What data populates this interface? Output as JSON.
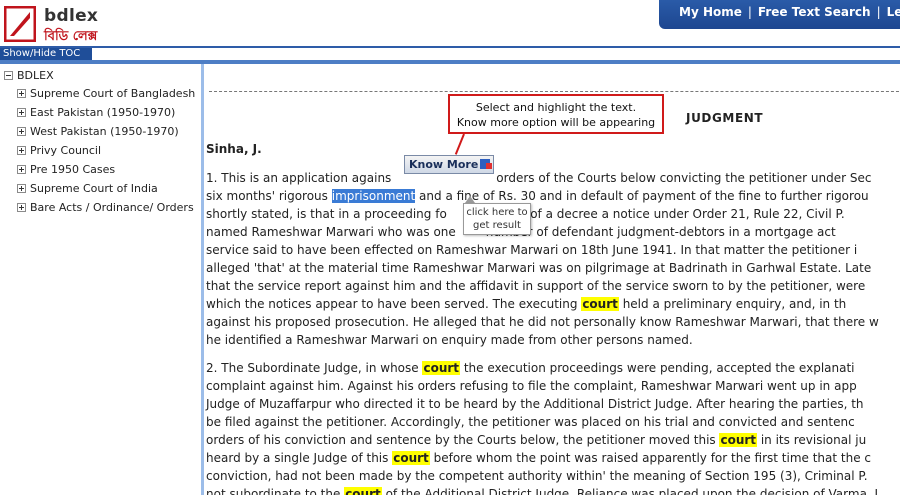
{
  "brand": {
    "name": "bdlex",
    "bangla_name": "বিডি লেক্স",
    "accent_color": "#c0141c",
    "nav_color": "#1f4e99"
  },
  "topnav": {
    "items": [
      "My Home",
      "Free Text Search",
      "Lega"
    ],
    "separator": "|"
  },
  "toc_toggle": "Show/Hide TOC",
  "sidebar": {
    "root": "BDLEX",
    "items": [
      "Supreme Court of Bangladesh",
      "East Pakistan (1950-1970)",
      "West Pakistan (1950-1970)",
      "Privy Council",
      "Pre 1950 Cases",
      "Supreme Court of India",
      "Bare Acts / Ordinance/ Orders"
    ]
  },
  "document": {
    "heading": "JUDGMENT",
    "author": "Sinha, J.",
    "p1": [
      [
        "1. This is an application agains",
        "",
        "",
        "",
        "",
        "orders of the Courts below convicting the petitioner under Sec"
      ],
      [
        "six months' rigorous ",
        "imprisonment",
        " and a fine of Rs. 30 and in default of payment of the fine to further rigorou"
      ],
      [
        "shortly stated, is that in a proceeding fo",
        "",
        "n of a decree a notice under Order 21, Rule 22, Civil P."
      ],
      [
        "named Rameshwar Marwari who was one",
        "",
        "number of defendant judgment-debtors in a mortgage act"
      ],
      [
        "service said to have been effected on Rameshwar Marwari on 18th June 1941. In that matter the petitioner i"
      ],
      [
        "alleged 'that' at the material time Rameshwar Marwari was on pilgrimage at Badrinath in Garhwal Estate. Late"
      ],
      [
        "that the service report against him and the affidavit in support of the service sworn to by the petitioner, were"
      ],
      [
        "which the notices appear to have been served. The executing ",
        "court",
        " held a preliminary enquiry, and, in th"
      ],
      [
        "against his proposed prosecution. He alleged that he did not personally know Rameshwar Marwari, that there w"
      ],
      [
        "he identified a Rameshwar Marwari on enquiry made from other persons named."
      ]
    ],
    "p2": [
      [
        "2. The Subordinate Judge, in whose ",
        "court",
        " the execution proceedings were pending, accepted the explanati"
      ],
      [
        "complaint against him. Against his orders refusing to file the complaint, Rameshwar Marwari went up in app"
      ],
      [
        "Judge of Muzaffarpur who directed it to be heard by the Additional District Judge. After hearing the parties, th"
      ],
      [
        "be filed against the petitioner. Accordingly, the petitioner was placed on his trial and convicted and sentenc"
      ],
      [
        "orders of his conviction and sentence by the Courts below, the petitioner moved this ",
        "court",
        " in its revisional ju"
      ],
      [
        "heard by a single Judge of this ",
        "court",
        " before whom the point was raised apparently for the first time that the c"
      ],
      [
        "conviction, had not been made by the competent authority within' the meaning of Section 195 (3), Criminal P."
      ],
      [
        "not subordinate to the ",
        "court",
        " of the Additional District Judge. Reliance was placed upon the decision of Varma, J"
      ]
    ]
  },
  "callout": {
    "line1": "Select and highlight the text.",
    "line2": "Know more option will be appearing"
  },
  "know_more_button": "Know More",
  "tooltip": {
    "line1": "click here to",
    "line2": "get result"
  }
}
